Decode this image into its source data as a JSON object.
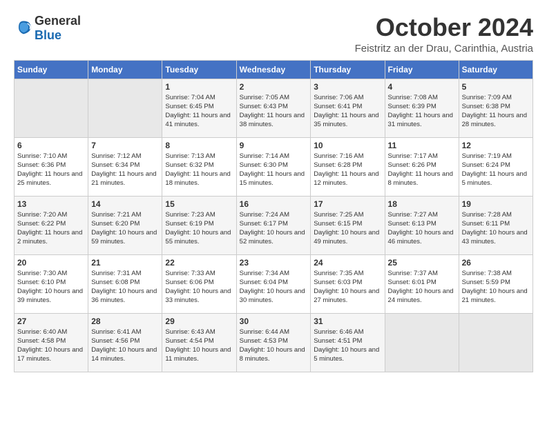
{
  "logo": {
    "general": "General",
    "blue": "Blue"
  },
  "title": "October 2024",
  "location": "Feistritz an der Drau, Carinthia, Austria",
  "days_of_week": [
    "Sunday",
    "Monday",
    "Tuesday",
    "Wednesday",
    "Thursday",
    "Friday",
    "Saturday"
  ],
  "weeks": [
    [
      {
        "day": "",
        "sunrise": "",
        "sunset": "",
        "daylight": ""
      },
      {
        "day": "",
        "sunrise": "",
        "sunset": "",
        "daylight": ""
      },
      {
        "day": "1",
        "sunrise": "Sunrise: 7:04 AM",
        "sunset": "Sunset: 6:45 PM",
        "daylight": "Daylight: 11 hours and 41 minutes."
      },
      {
        "day": "2",
        "sunrise": "Sunrise: 7:05 AM",
        "sunset": "Sunset: 6:43 PM",
        "daylight": "Daylight: 11 hours and 38 minutes."
      },
      {
        "day": "3",
        "sunrise": "Sunrise: 7:06 AM",
        "sunset": "Sunset: 6:41 PM",
        "daylight": "Daylight: 11 hours and 35 minutes."
      },
      {
        "day": "4",
        "sunrise": "Sunrise: 7:08 AM",
        "sunset": "Sunset: 6:39 PM",
        "daylight": "Daylight: 11 hours and 31 minutes."
      },
      {
        "day": "5",
        "sunrise": "Sunrise: 7:09 AM",
        "sunset": "Sunset: 6:38 PM",
        "daylight": "Daylight: 11 hours and 28 minutes."
      }
    ],
    [
      {
        "day": "6",
        "sunrise": "Sunrise: 7:10 AM",
        "sunset": "Sunset: 6:36 PM",
        "daylight": "Daylight: 11 hours and 25 minutes."
      },
      {
        "day": "7",
        "sunrise": "Sunrise: 7:12 AM",
        "sunset": "Sunset: 6:34 PM",
        "daylight": "Daylight: 11 hours and 21 minutes."
      },
      {
        "day": "8",
        "sunrise": "Sunrise: 7:13 AM",
        "sunset": "Sunset: 6:32 PM",
        "daylight": "Daylight: 11 hours and 18 minutes."
      },
      {
        "day": "9",
        "sunrise": "Sunrise: 7:14 AM",
        "sunset": "Sunset: 6:30 PM",
        "daylight": "Daylight: 11 hours and 15 minutes."
      },
      {
        "day": "10",
        "sunrise": "Sunrise: 7:16 AM",
        "sunset": "Sunset: 6:28 PM",
        "daylight": "Daylight: 11 hours and 12 minutes."
      },
      {
        "day": "11",
        "sunrise": "Sunrise: 7:17 AM",
        "sunset": "Sunset: 6:26 PM",
        "daylight": "Daylight: 11 hours and 8 minutes."
      },
      {
        "day": "12",
        "sunrise": "Sunrise: 7:19 AM",
        "sunset": "Sunset: 6:24 PM",
        "daylight": "Daylight: 11 hours and 5 minutes."
      }
    ],
    [
      {
        "day": "13",
        "sunrise": "Sunrise: 7:20 AM",
        "sunset": "Sunset: 6:22 PM",
        "daylight": "Daylight: 11 hours and 2 minutes."
      },
      {
        "day": "14",
        "sunrise": "Sunrise: 7:21 AM",
        "sunset": "Sunset: 6:20 PM",
        "daylight": "Daylight: 10 hours and 59 minutes."
      },
      {
        "day": "15",
        "sunrise": "Sunrise: 7:23 AM",
        "sunset": "Sunset: 6:19 PM",
        "daylight": "Daylight: 10 hours and 55 minutes."
      },
      {
        "day": "16",
        "sunrise": "Sunrise: 7:24 AM",
        "sunset": "Sunset: 6:17 PM",
        "daylight": "Daylight: 10 hours and 52 minutes."
      },
      {
        "day": "17",
        "sunrise": "Sunrise: 7:25 AM",
        "sunset": "Sunset: 6:15 PM",
        "daylight": "Daylight: 10 hours and 49 minutes."
      },
      {
        "day": "18",
        "sunrise": "Sunrise: 7:27 AM",
        "sunset": "Sunset: 6:13 PM",
        "daylight": "Daylight: 10 hours and 46 minutes."
      },
      {
        "day": "19",
        "sunrise": "Sunrise: 7:28 AM",
        "sunset": "Sunset: 6:11 PM",
        "daylight": "Daylight: 10 hours and 43 minutes."
      }
    ],
    [
      {
        "day": "20",
        "sunrise": "Sunrise: 7:30 AM",
        "sunset": "Sunset: 6:10 PM",
        "daylight": "Daylight: 10 hours and 39 minutes."
      },
      {
        "day": "21",
        "sunrise": "Sunrise: 7:31 AM",
        "sunset": "Sunset: 6:08 PM",
        "daylight": "Daylight: 10 hours and 36 minutes."
      },
      {
        "day": "22",
        "sunrise": "Sunrise: 7:33 AM",
        "sunset": "Sunset: 6:06 PM",
        "daylight": "Daylight: 10 hours and 33 minutes."
      },
      {
        "day": "23",
        "sunrise": "Sunrise: 7:34 AM",
        "sunset": "Sunset: 6:04 PM",
        "daylight": "Daylight: 10 hours and 30 minutes."
      },
      {
        "day": "24",
        "sunrise": "Sunrise: 7:35 AM",
        "sunset": "Sunset: 6:03 PM",
        "daylight": "Daylight: 10 hours and 27 minutes."
      },
      {
        "day": "25",
        "sunrise": "Sunrise: 7:37 AM",
        "sunset": "Sunset: 6:01 PM",
        "daylight": "Daylight: 10 hours and 24 minutes."
      },
      {
        "day": "26",
        "sunrise": "Sunrise: 7:38 AM",
        "sunset": "Sunset: 5:59 PM",
        "daylight": "Daylight: 10 hours and 21 minutes."
      }
    ],
    [
      {
        "day": "27",
        "sunrise": "Sunrise: 6:40 AM",
        "sunset": "Sunset: 4:58 PM",
        "daylight": "Daylight: 10 hours and 17 minutes."
      },
      {
        "day": "28",
        "sunrise": "Sunrise: 6:41 AM",
        "sunset": "Sunset: 4:56 PM",
        "daylight": "Daylight: 10 hours and 14 minutes."
      },
      {
        "day": "29",
        "sunrise": "Sunrise: 6:43 AM",
        "sunset": "Sunset: 4:54 PM",
        "daylight": "Daylight: 10 hours and 11 minutes."
      },
      {
        "day": "30",
        "sunrise": "Sunrise: 6:44 AM",
        "sunset": "Sunset: 4:53 PM",
        "daylight": "Daylight: 10 hours and 8 minutes."
      },
      {
        "day": "31",
        "sunrise": "Sunrise: 6:46 AM",
        "sunset": "Sunset: 4:51 PM",
        "daylight": "Daylight: 10 hours and 5 minutes."
      },
      {
        "day": "",
        "sunrise": "",
        "sunset": "",
        "daylight": ""
      },
      {
        "day": "",
        "sunrise": "",
        "sunset": "",
        "daylight": ""
      }
    ]
  ]
}
